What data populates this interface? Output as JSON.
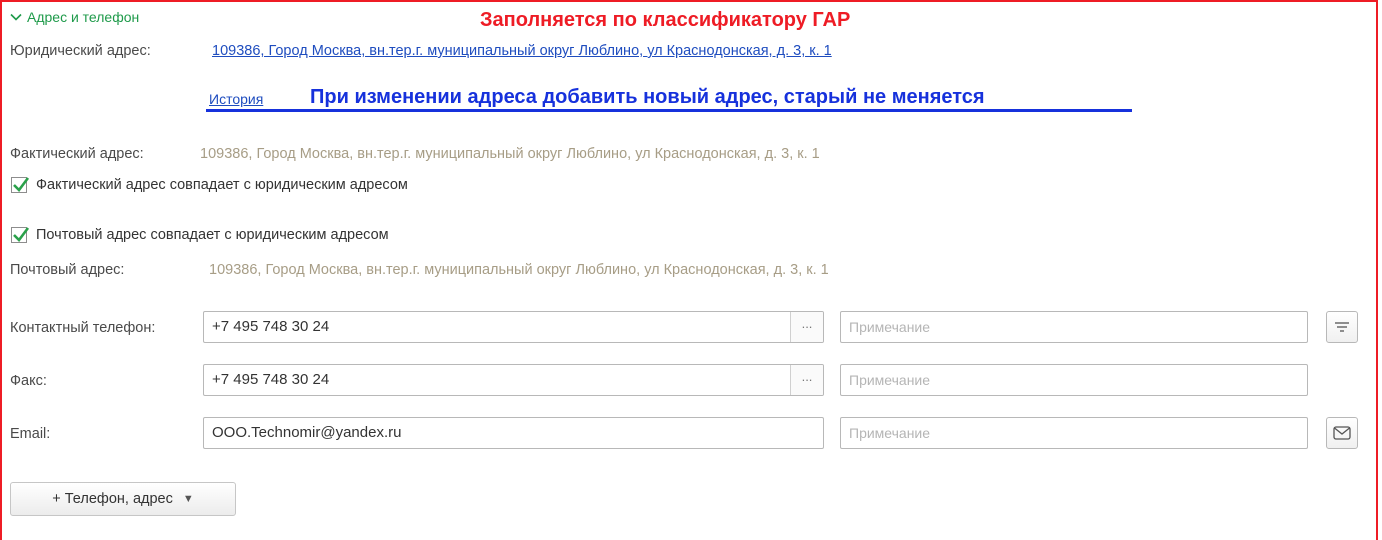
{
  "group": {
    "title": "Адрес и телефон"
  },
  "annotations": {
    "gar": "Заполняется по классификатору ГАР",
    "history_note": "При изменении адреса добавить новый адрес, старый не меняется"
  },
  "legal_address": {
    "label": "Юридический адрес:",
    "value": "109386, Город Москва, вн.тер.г. муниципальный округ Люблино, ул Краснодонская, д. 3, к. 1",
    "history_link": "История"
  },
  "actual_address": {
    "label": "Фактический адрес:",
    "value": "109386, Город Москва, вн.тер.г. муниципальный округ Люблино, ул Краснодонская, д. 3, к. 1",
    "checkbox_label": "Фактический адрес совпадает с юридическим адресом",
    "checked": true
  },
  "postal_address": {
    "checkbox_label": "Почтовый адрес совпадает с юридическим адресом",
    "checked": true,
    "label": "Почтовый адрес:",
    "value": "109386, Город Москва, вн.тер.г. муниципальный округ Люблино, ул Краснодонская, д. 3, к. 1"
  },
  "contacts": {
    "phone": {
      "label": "Контактный телефон:",
      "value": "+7 495 748 30 24",
      "select": "...",
      "note_placeholder": "Примечание"
    },
    "fax": {
      "label": "Факс:",
      "value": "+7 495 748 30 24",
      "select": "...",
      "note_placeholder": "Примечание"
    },
    "email": {
      "label": "Email:",
      "value": "OOO.Technomir@yandex.ru",
      "note_placeholder": "Примечание"
    }
  },
  "add_button": {
    "label": "+ Телефон, адрес",
    "arrow": "▼"
  },
  "colors": {
    "frame": "#ee1c25",
    "group_header": "#1e9a4a",
    "annotation_blue": "#1631dc",
    "link": "#1f4dbf",
    "inactive_address": "#a79d86",
    "checkmark": "#2aa14a"
  }
}
